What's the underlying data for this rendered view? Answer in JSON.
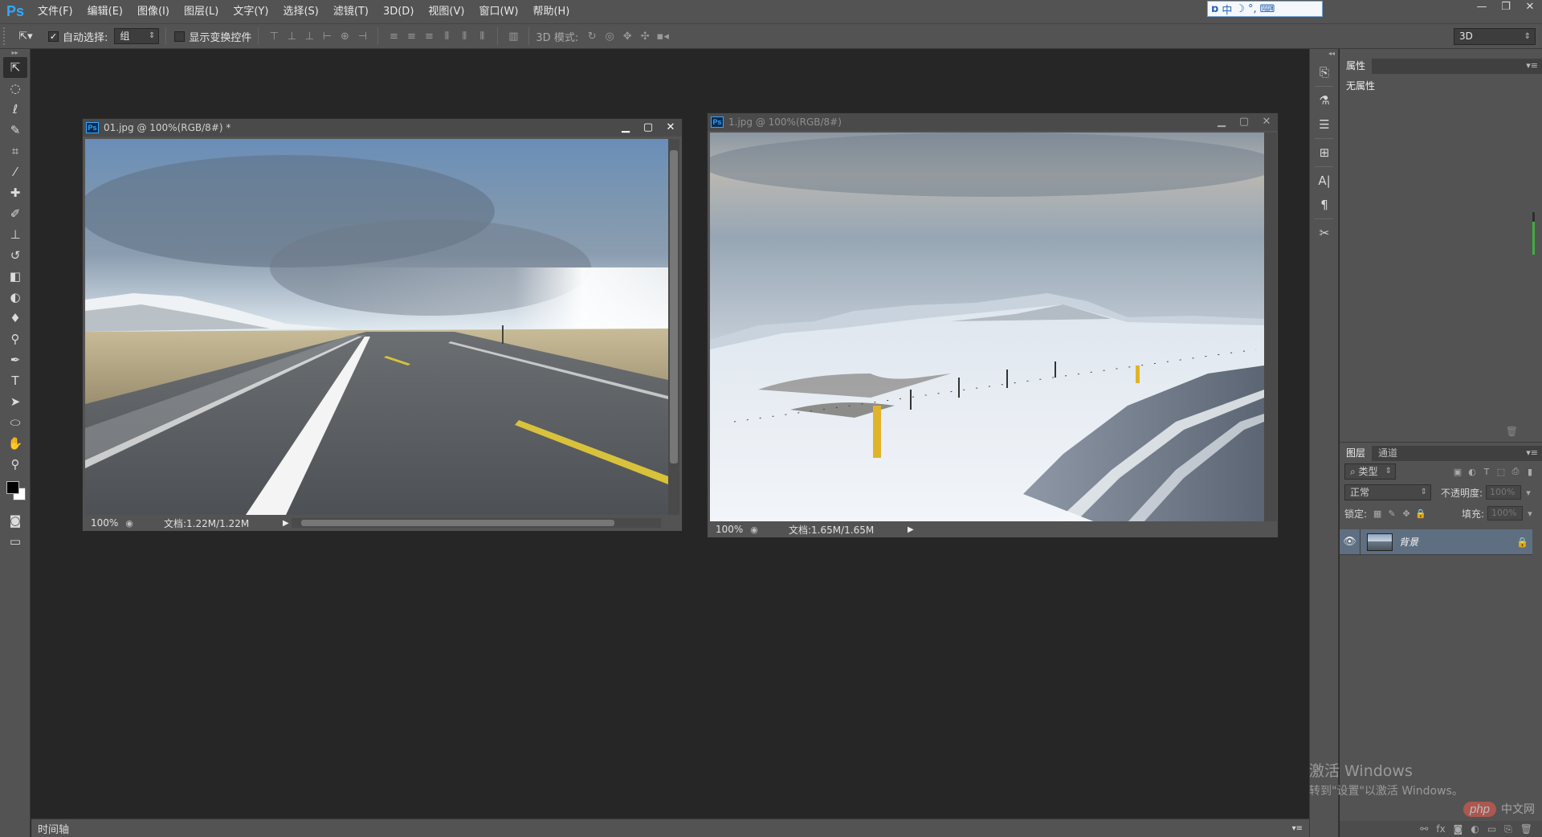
{
  "app": {
    "logo": "Ps"
  },
  "menu": [
    "文件(F)",
    "编辑(E)",
    "图像(I)",
    "图层(L)",
    "文字(Y)",
    "选择(S)",
    "滤镜(T)",
    "3D(D)",
    "视图(V)",
    "窗口(W)",
    "帮助(H)"
  ],
  "ime": {
    "items": [
      "中",
      "☽",
      "°,",
      "⌨"
    ]
  },
  "window_controls": [
    "—",
    "❐",
    "✕"
  ],
  "options": {
    "auto_select_label": "自动选择:",
    "auto_select_value": "组",
    "show_transform_label": "显示变换控件",
    "mode_3d_label": "3D 模式:",
    "workspace": "3D"
  },
  "documents": [
    {
      "title": "01.jpg @ 100%(RGB/8#) *",
      "zoom": "100%",
      "doc_size": "文档:1.22M/1.22M",
      "active": true
    },
    {
      "title": "1.jpg @ 100%(RGB/8#)",
      "zoom": "100%",
      "doc_size": "文档:1.65M/1.65M",
      "active": false
    }
  ],
  "timeline": {
    "label": "时间轴"
  },
  "properties_panel": {
    "tab": "属性",
    "empty_text": "无属性"
  },
  "layers_panel": {
    "tabs": [
      "图层",
      "通道"
    ],
    "filter_kind": "类型",
    "blend_mode": "正常",
    "opacity_label": "不透明度:",
    "opacity_value": "100%",
    "lock_label": "锁定:",
    "fill_label": "填充:",
    "fill_value": "100%",
    "layers": [
      {
        "name": "背景",
        "locked": true,
        "visible": true
      }
    ]
  },
  "watermark": {
    "activate_line1": "激活 Windows",
    "activate_line2": "转到\"设置\"以激活 Windows。",
    "site_badge": "php",
    "site_cn": "中文网"
  },
  "colors": {
    "ui_bg": "#535353",
    "workspace_bg": "#262626",
    "selected_layer": "#5f6f82",
    "ps_blue": "#31a8ff"
  }
}
